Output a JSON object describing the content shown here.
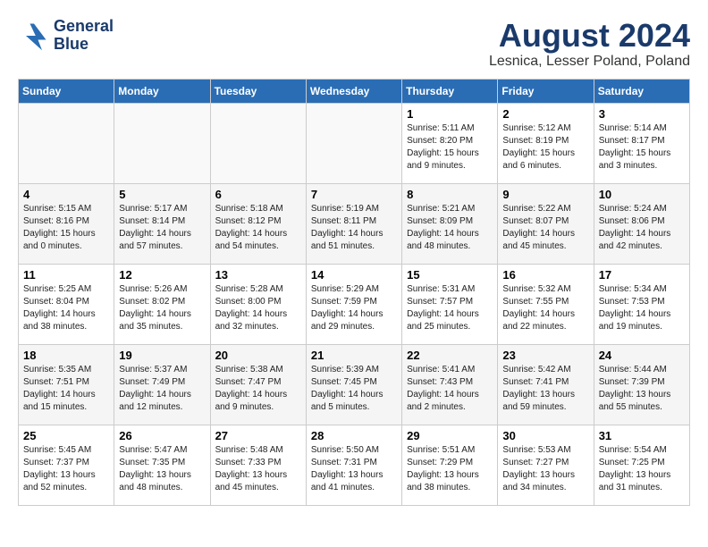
{
  "header": {
    "logo_line1": "General",
    "logo_line2": "Blue",
    "month": "August 2024",
    "location": "Lesnica, Lesser Poland, Poland"
  },
  "weekdays": [
    "Sunday",
    "Monday",
    "Tuesday",
    "Wednesday",
    "Thursday",
    "Friday",
    "Saturday"
  ],
  "weeks": [
    [
      {
        "day": "",
        "info": ""
      },
      {
        "day": "",
        "info": ""
      },
      {
        "day": "",
        "info": ""
      },
      {
        "day": "",
        "info": ""
      },
      {
        "day": "1",
        "info": "Sunrise: 5:11 AM\nSunset: 8:20 PM\nDaylight: 15 hours\nand 9 minutes."
      },
      {
        "day": "2",
        "info": "Sunrise: 5:12 AM\nSunset: 8:19 PM\nDaylight: 15 hours\nand 6 minutes."
      },
      {
        "day": "3",
        "info": "Sunrise: 5:14 AM\nSunset: 8:17 PM\nDaylight: 15 hours\nand 3 minutes."
      }
    ],
    [
      {
        "day": "4",
        "info": "Sunrise: 5:15 AM\nSunset: 8:16 PM\nDaylight: 15 hours\nand 0 minutes."
      },
      {
        "day": "5",
        "info": "Sunrise: 5:17 AM\nSunset: 8:14 PM\nDaylight: 14 hours\nand 57 minutes."
      },
      {
        "day": "6",
        "info": "Sunrise: 5:18 AM\nSunset: 8:12 PM\nDaylight: 14 hours\nand 54 minutes."
      },
      {
        "day": "7",
        "info": "Sunrise: 5:19 AM\nSunset: 8:11 PM\nDaylight: 14 hours\nand 51 minutes."
      },
      {
        "day": "8",
        "info": "Sunrise: 5:21 AM\nSunset: 8:09 PM\nDaylight: 14 hours\nand 48 minutes."
      },
      {
        "day": "9",
        "info": "Sunrise: 5:22 AM\nSunset: 8:07 PM\nDaylight: 14 hours\nand 45 minutes."
      },
      {
        "day": "10",
        "info": "Sunrise: 5:24 AM\nSunset: 8:06 PM\nDaylight: 14 hours\nand 42 minutes."
      }
    ],
    [
      {
        "day": "11",
        "info": "Sunrise: 5:25 AM\nSunset: 8:04 PM\nDaylight: 14 hours\nand 38 minutes."
      },
      {
        "day": "12",
        "info": "Sunrise: 5:26 AM\nSunset: 8:02 PM\nDaylight: 14 hours\nand 35 minutes."
      },
      {
        "day": "13",
        "info": "Sunrise: 5:28 AM\nSunset: 8:00 PM\nDaylight: 14 hours\nand 32 minutes."
      },
      {
        "day": "14",
        "info": "Sunrise: 5:29 AM\nSunset: 7:59 PM\nDaylight: 14 hours\nand 29 minutes."
      },
      {
        "day": "15",
        "info": "Sunrise: 5:31 AM\nSunset: 7:57 PM\nDaylight: 14 hours\nand 25 minutes."
      },
      {
        "day": "16",
        "info": "Sunrise: 5:32 AM\nSunset: 7:55 PM\nDaylight: 14 hours\nand 22 minutes."
      },
      {
        "day": "17",
        "info": "Sunrise: 5:34 AM\nSunset: 7:53 PM\nDaylight: 14 hours\nand 19 minutes."
      }
    ],
    [
      {
        "day": "18",
        "info": "Sunrise: 5:35 AM\nSunset: 7:51 PM\nDaylight: 14 hours\nand 15 minutes."
      },
      {
        "day": "19",
        "info": "Sunrise: 5:37 AM\nSunset: 7:49 PM\nDaylight: 14 hours\nand 12 minutes."
      },
      {
        "day": "20",
        "info": "Sunrise: 5:38 AM\nSunset: 7:47 PM\nDaylight: 14 hours\nand 9 minutes."
      },
      {
        "day": "21",
        "info": "Sunrise: 5:39 AM\nSunset: 7:45 PM\nDaylight: 14 hours\nand 5 minutes."
      },
      {
        "day": "22",
        "info": "Sunrise: 5:41 AM\nSunset: 7:43 PM\nDaylight: 14 hours\nand 2 minutes."
      },
      {
        "day": "23",
        "info": "Sunrise: 5:42 AM\nSunset: 7:41 PM\nDaylight: 13 hours\nand 59 minutes."
      },
      {
        "day": "24",
        "info": "Sunrise: 5:44 AM\nSunset: 7:39 PM\nDaylight: 13 hours\nand 55 minutes."
      }
    ],
    [
      {
        "day": "25",
        "info": "Sunrise: 5:45 AM\nSunset: 7:37 PM\nDaylight: 13 hours\nand 52 minutes."
      },
      {
        "day": "26",
        "info": "Sunrise: 5:47 AM\nSunset: 7:35 PM\nDaylight: 13 hours\nand 48 minutes."
      },
      {
        "day": "27",
        "info": "Sunrise: 5:48 AM\nSunset: 7:33 PM\nDaylight: 13 hours\nand 45 minutes."
      },
      {
        "day": "28",
        "info": "Sunrise: 5:50 AM\nSunset: 7:31 PM\nDaylight: 13 hours\nand 41 minutes."
      },
      {
        "day": "29",
        "info": "Sunrise: 5:51 AM\nSunset: 7:29 PM\nDaylight: 13 hours\nand 38 minutes."
      },
      {
        "day": "30",
        "info": "Sunrise: 5:53 AM\nSunset: 7:27 PM\nDaylight: 13 hours\nand 34 minutes."
      },
      {
        "day": "31",
        "info": "Sunrise: 5:54 AM\nSunset: 7:25 PM\nDaylight: 13 hours\nand 31 minutes."
      }
    ]
  ]
}
